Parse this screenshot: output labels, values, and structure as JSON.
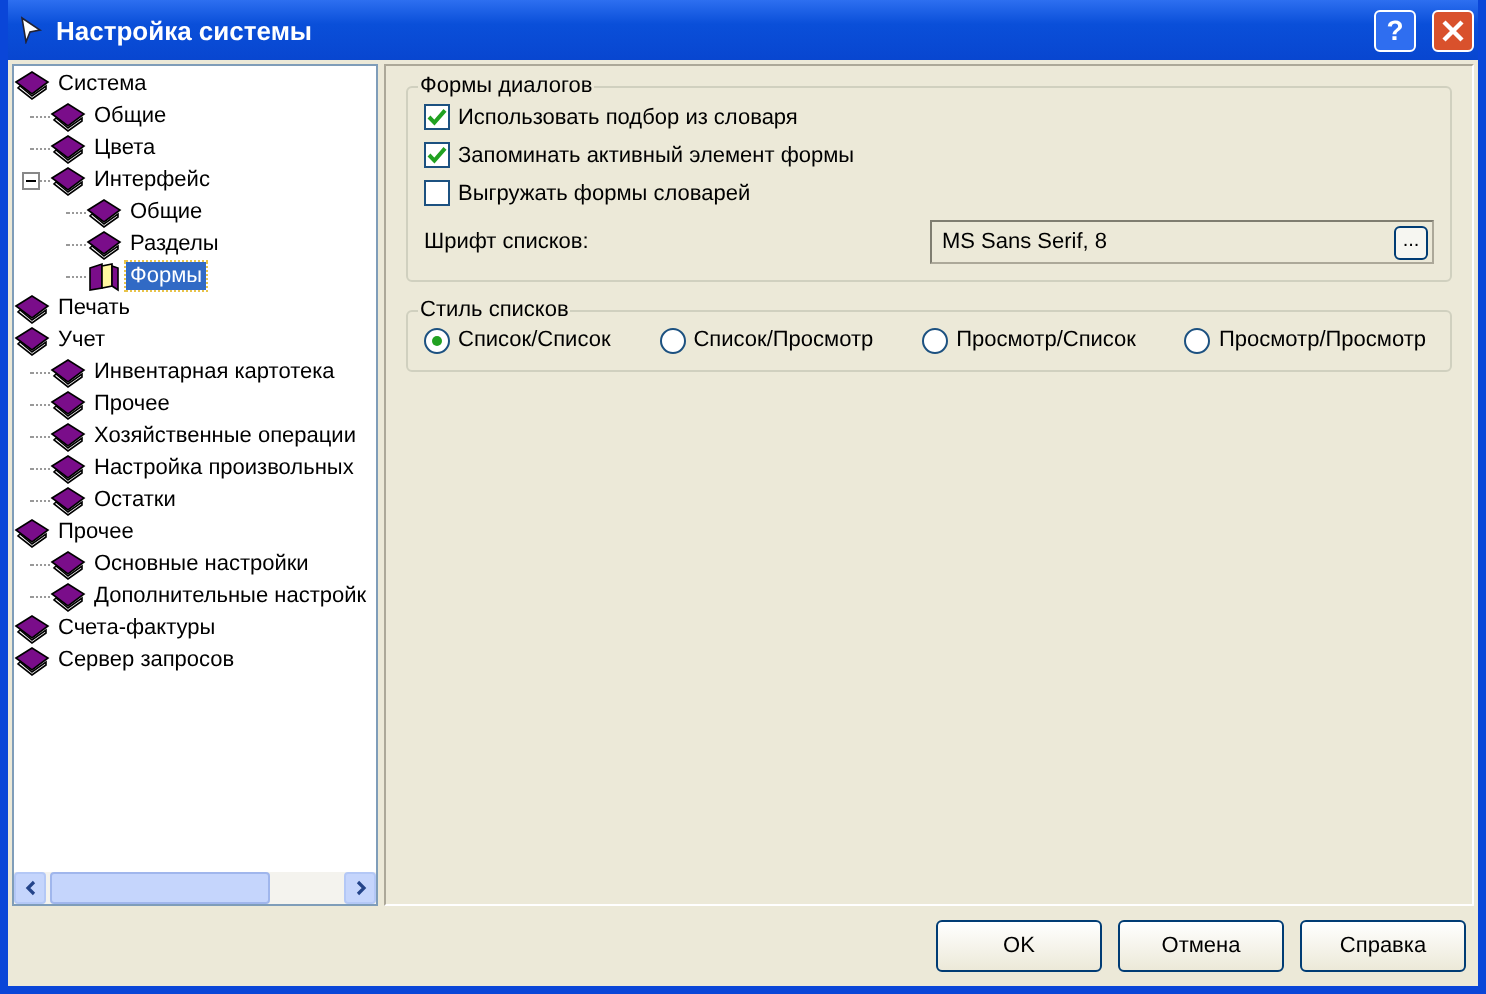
{
  "window": {
    "title": "Настройка системы",
    "help_button": "?"
  },
  "tree": [
    {
      "label": "Система",
      "selected": false,
      "children": [
        {
          "label": "Общие",
          "selected": false
        },
        {
          "label": "Цвета",
          "selected": false
        },
        {
          "label": "Интерфейс",
          "selected": false,
          "expanded": true,
          "children": [
            {
              "label": "Общие",
              "selected": false
            },
            {
              "label": "Разделы",
              "selected": false
            },
            {
              "label": "Формы",
              "selected": true
            }
          ]
        }
      ]
    },
    {
      "label": "Печать",
      "selected": false
    },
    {
      "label": "Учет",
      "selected": false,
      "children": [
        {
          "label": "Инвентарная картотека",
          "selected": false
        },
        {
          "label": "Прочее",
          "selected": false
        },
        {
          "label": "Хозяйственные операции",
          "selected": false
        },
        {
          "label": "Настройка произвольных",
          "selected": false
        },
        {
          "label": "Остатки",
          "selected": false
        }
      ]
    },
    {
      "label": "Прочее",
      "selected": false,
      "children": [
        {
          "label": "Основные настройки",
          "selected": false
        },
        {
          "label": "Дополнительные настройк",
          "selected": false
        }
      ]
    },
    {
      "label": "Счета-фактуры",
      "selected": false
    },
    {
      "label": "Сервер запросов",
      "selected": false
    }
  ],
  "forms_group": {
    "title": "Формы диалогов",
    "options": [
      {
        "label": "Использовать подбор из словаря",
        "checked": true
      },
      {
        "label": "Запоминать активный элемент формы",
        "checked": true
      },
      {
        "label": "Выгружать формы словарей",
        "checked": false
      }
    ],
    "font_label": "Шрифт списков:",
    "font_value": "MS Sans Serif, 8",
    "browse_button": "..."
  },
  "list_style_group": {
    "title": "Стиль списков",
    "options": [
      {
        "label": "Список/Список",
        "selected": true
      },
      {
        "label": "Список/Просмотр",
        "selected": false
      },
      {
        "label": "Просмотр/Список",
        "selected": false
      },
      {
        "label": "Просмотр/Просмотр",
        "selected": false
      }
    ]
  },
  "buttons": [
    "OK",
    "Отмена",
    "Справка"
  ]
}
